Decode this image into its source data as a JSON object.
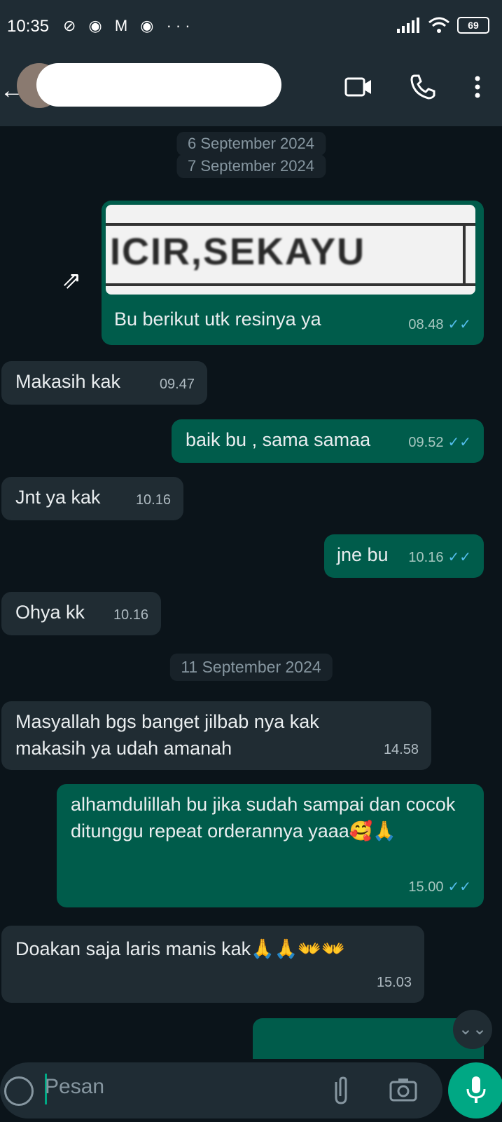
{
  "statusbar": {
    "time": "10:35",
    "notif_icons": "⊘ ◉ M ◉ ···",
    "battery": "69"
  },
  "header": {
    "contact_name": ""
  },
  "chat": {
    "date_chips": [
      "6 September 2024",
      "7 September 2024",
      "11 September 2024"
    ],
    "image_text": "ICIR,SEKAYU",
    "messages": [
      {
        "dir": "out",
        "text": "Bu berikut utk resinya ya",
        "time": "08.48"
      },
      {
        "dir": "in",
        "text": "Makasih kak",
        "time": "09.47"
      },
      {
        "dir": "out",
        "text": "baik bu , sama samaa",
        "time": "09.52"
      },
      {
        "dir": "in",
        "text": "Jnt ya kak",
        "time": "10.16"
      },
      {
        "dir": "out",
        "text": "jne bu",
        "time": "10.16"
      },
      {
        "dir": "in",
        "text": "Ohya kk",
        "time": "10.16"
      },
      {
        "dir": "in",
        "text": "Masyallah bgs banget jilbab nya kak\nmakasih ya udah amanah",
        "time": "14.58"
      },
      {
        "dir": "out",
        "text": "alhamdulillah bu jika sudah sampai dan cocok\nditunggu repeat orderannya yaaa🥰🙏",
        "time": "15.00"
      },
      {
        "dir": "in",
        "text": "Doakan saja laris manis kak🙏🙏👐👐",
        "time": "15.03"
      }
    ]
  },
  "input": {
    "placeholder": "Pesan"
  },
  "colors": {
    "incoming": "#202c33",
    "outgoing": "#005c4b",
    "accent": "#00a884",
    "read_tick": "#53bdeb"
  },
  "icons": [
    "back-icon",
    "video-call-icon",
    "phone-icon",
    "more-icon",
    "forward-icon",
    "emoji-icon",
    "attach-icon",
    "camera-icon",
    "mic-icon",
    "scroll-down-icon"
  ]
}
